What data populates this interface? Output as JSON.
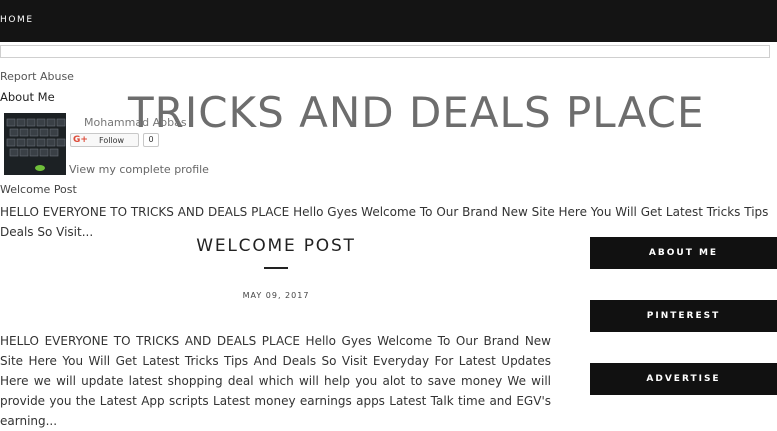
{
  "nav": {
    "home": "HOME"
  },
  "search": {
    "placeholder": ""
  },
  "report_abuse": "Report Abuse",
  "about_me_heading": "About Me",
  "site_title": "TRICKS AND DEALS PLACE",
  "profile": {
    "name": "Mohammad Abbas",
    "follow_label": "Follow",
    "follow_count": "0",
    "view_profile": "View my complete profile"
  },
  "welcome_widget": {
    "heading": "Welcome Post",
    "snippet_line1": "HELLO EVERYONE TO TRICKS AND DEALS PLACE Hello Gyes Welcome To Our Brand New Site Here You Will Get Latest Tricks Tips",
    "snippet_line2": "Deals So Visit..."
  },
  "post": {
    "title": "WELCOME POST",
    "date": "MAY 09, 2017",
    "body": "HELLO EVERYONE TO TRICKS AND DEALS PLACE Hello Gyes Welcome To Our Brand New Site Here You Will Get Latest Tricks Tips And Deals So Visit Everyday For Latest Updates Here we will update latest shopping deal which will help you alot to save money We will provide you the Latest App scripts Latest money earnings apps Latest Talk time and EGV's earning..."
  },
  "sidebar": {
    "buttons": [
      {
        "label": "ABOUT ME"
      },
      {
        "label": "PINTEREST"
      },
      {
        "label": "ADVERTISE"
      }
    ]
  }
}
